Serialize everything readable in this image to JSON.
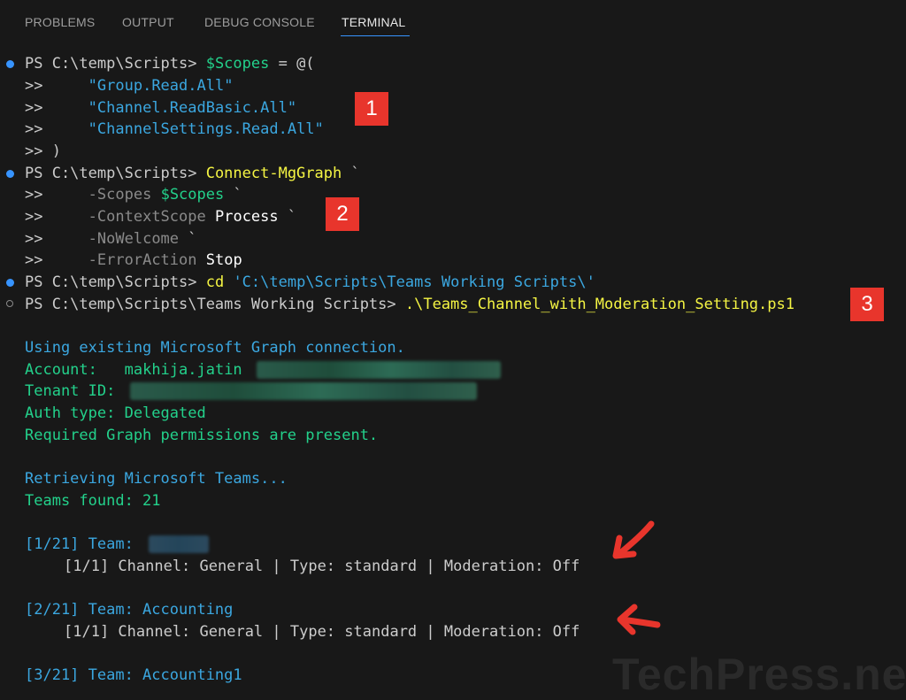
{
  "panel_tabs": [
    "PROBLEMS",
    "OUTPUT",
    "DEBUG CONSOLE",
    "TERMINAL"
  ],
  "active_tab": "TERMINAL",
  "terminal": {
    "block1": {
      "prompt": "PS C:\\temp\\Scripts> ",
      "var": "$Scopes",
      "assign": " = @(",
      "cont": ">>",
      "s1": "\"Group.Read.All\"",
      "s2": "\"Channel.ReadBasic.All\"",
      "s3": "\"ChannelSettings.Read.All\"",
      "close": ">> )"
    },
    "block2": {
      "prompt": "PS C:\\temp\\Scripts> ",
      "cmd": "Connect-MgGraph",
      "tick": " `",
      "p1": "-Scopes",
      "p1v": "$Scopes",
      "p2": "-ContextScope",
      "p2v": "Process",
      "p3": "-NoWelcome",
      "p4": "-ErrorAction",
      "p4v": "Stop"
    },
    "block3": {
      "prompt": "PS C:\\temp\\Scripts> ",
      "cmd": "cd",
      "arg": "'C:\\temp\\Scripts\\Teams Working Scripts\\'"
    },
    "block4": {
      "prompt": "PS C:\\temp\\Scripts\\Teams Working Scripts> ",
      "cmd": ".\\Teams_Channel_with_Moderation_Setting.ps1"
    },
    "output": {
      "using": "Using existing Microsoft Graph connection.",
      "account_label": "Account:",
      "account_value": "makhija.jatin",
      "tenant_label": "Tenant ID:",
      "auth": "Auth type: Delegated",
      "perms": "Required Graph permissions are present.",
      "retrieving": "Retrieving Microsoft Teams...",
      "found": "Teams found: 21",
      "team1": "[1/21] Team:",
      "team1_ch": "[1/1] Channel: General | Type: standard | Moderation: Off",
      "team2": "[2/21] Team: Accounting",
      "team2_ch": "[1/1] Channel: General | Type: standard | Moderation: Off",
      "team3": "[3/21] Team: Accounting1"
    }
  },
  "badges": [
    "1",
    "2",
    "3"
  ],
  "watermark": "TechPress.net",
  "colors": {
    "background": "#181818",
    "prompt": "#cccccc",
    "command": "#f5f543",
    "variable": "#23d18b",
    "string": "#3ba7e0",
    "parameter": "#8a8a8a",
    "badge": "#e8352c",
    "arrow": "#e8352c"
  }
}
